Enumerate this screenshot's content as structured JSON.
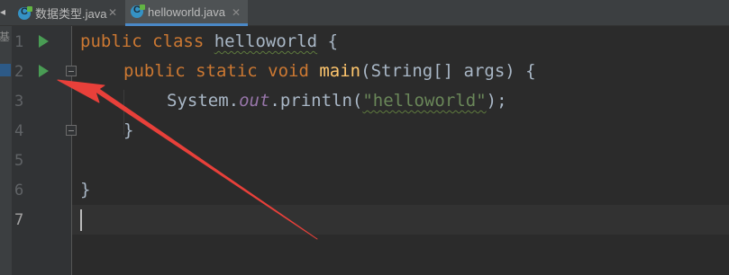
{
  "tabs": [
    {
      "label": "数据类型.java",
      "close": "✕",
      "icon": "java-class-icon"
    },
    {
      "label": "helloworld.java",
      "close": "✕",
      "icon": "java-class-icon",
      "active": true
    }
  ],
  "left_strip_text": "基",
  "line_numbers": [
    "1",
    "2",
    "3",
    "4",
    "5",
    "6",
    "7"
  ],
  "current_line": "7",
  "code": {
    "line1": {
      "kw": "public class",
      "name": "helloworld",
      "rest": " {"
    },
    "line2": {
      "kw": "public static void",
      "fn": "main",
      "rest": "(String[] args) {"
    },
    "line3": {
      "pre": "System.",
      "field": "out",
      "mid": ".println(",
      "str": "\"helloworld\"",
      "end": ");"
    },
    "line4": "}",
    "line6": "}"
  },
  "colors": {
    "background": "#2b2b2b",
    "keyword": "#cc7832",
    "method": "#ffc66d",
    "string": "#6a8759",
    "field": "#9876aa",
    "text": "#a9b7c6",
    "run_icon": "#499c54",
    "annotation_arrow": "#e8403a"
  }
}
